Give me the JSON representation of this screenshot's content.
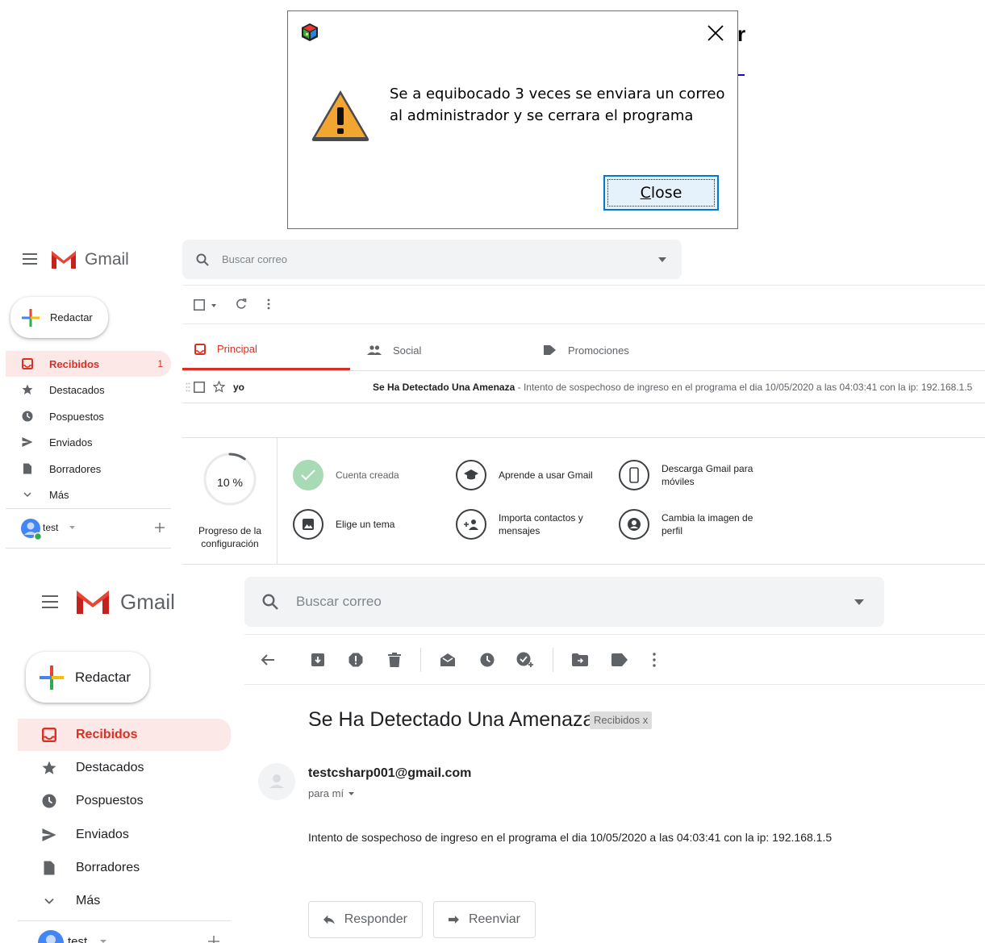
{
  "dialog": {
    "message": "Se a equibocado 3 veces se enviara un correo al administrador y se cerrara el programa",
    "close_button_rest": "lose",
    "close_button_mnemonic": "C"
  },
  "background_peek": {
    "letter": "r"
  },
  "inbox": {
    "logo_text": "Gmail",
    "search_placeholder": "Buscar correo",
    "compose_label": "Redactar",
    "nav": [
      {
        "label": "Recibidos",
        "count": "1",
        "icon": "inbox-icon"
      },
      {
        "label": "Destacados",
        "icon": "star-icon"
      },
      {
        "label": "Pospuestos",
        "icon": "clock-icon"
      },
      {
        "label": "Enviados",
        "icon": "send-icon"
      },
      {
        "label": "Borradores",
        "icon": "draft-icon"
      },
      {
        "label": "Más",
        "icon": "chevron-down-icon"
      }
    ],
    "account": {
      "name": "test"
    },
    "tabs": [
      {
        "label": "Principal",
        "icon": "inbox-icon"
      },
      {
        "label": "Social",
        "icon": "people-icon"
      },
      {
        "label": "Promociones",
        "icon": "tag-icon"
      }
    ],
    "mail": {
      "sender": "yo",
      "subject": "Se Ha Detectado Una Amenaza",
      "snippet": " - Intento de sospechoso de ingreso en el programa el dia 10/05/2020 a las 04:03:41 con la ip: 192.168.1.5"
    },
    "setup": {
      "progress_text": "10 %",
      "progress_value": 0.1,
      "progress_label": "Progreso de la configuración",
      "items": [
        {
          "label": "Cuenta creada",
          "icon": "check-icon",
          "done": true
        },
        {
          "label": "Aprende a usar Gmail",
          "icon": "school-icon"
        },
        {
          "label": "Descarga Gmail para móviles",
          "icon": "phone-icon"
        },
        {
          "label": "Elige un tema",
          "icon": "image-icon"
        },
        {
          "label": "Importa contactos y mensajes",
          "icon": "person-add-icon"
        },
        {
          "label": "Cambia la imagen de perfil",
          "icon": "account-circle-icon"
        }
      ]
    }
  },
  "message_view": {
    "logo_text": "Gmail",
    "search_placeholder": "Buscar correo",
    "compose_label": "Redactar",
    "nav": [
      {
        "label": "Recibidos",
        "icon": "inbox-icon"
      },
      {
        "label": "Destacados",
        "icon": "star-icon"
      },
      {
        "label": "Pospuestos",
        "icon": "clock-icon"
      },
      {
        "label": "Enviados",
        "icon": "send-icon"
      },
      {
        "label": "Borradores",
        "icon": "draft-icon"
      },
      {
        "label": "Más",
        "icon": "chevron-down-icon"
      }
    ],
    "account": {
      "name": "test"
    },
    "subject": "Se Ha Detectado Una Amenaza",
    "label_chip": "Recibidos x",
    "from": "testcsharp001@gmail.com",
    "to": "para mí",
    "body": "Intento de sospechoso de ingreso en el programa el dia 10/05/2020 a las 04:03:41 con la ip: 192.168.1.5",
    "reply_label": "Responder",
    "forward_label": "Reenviar"
  }
}
